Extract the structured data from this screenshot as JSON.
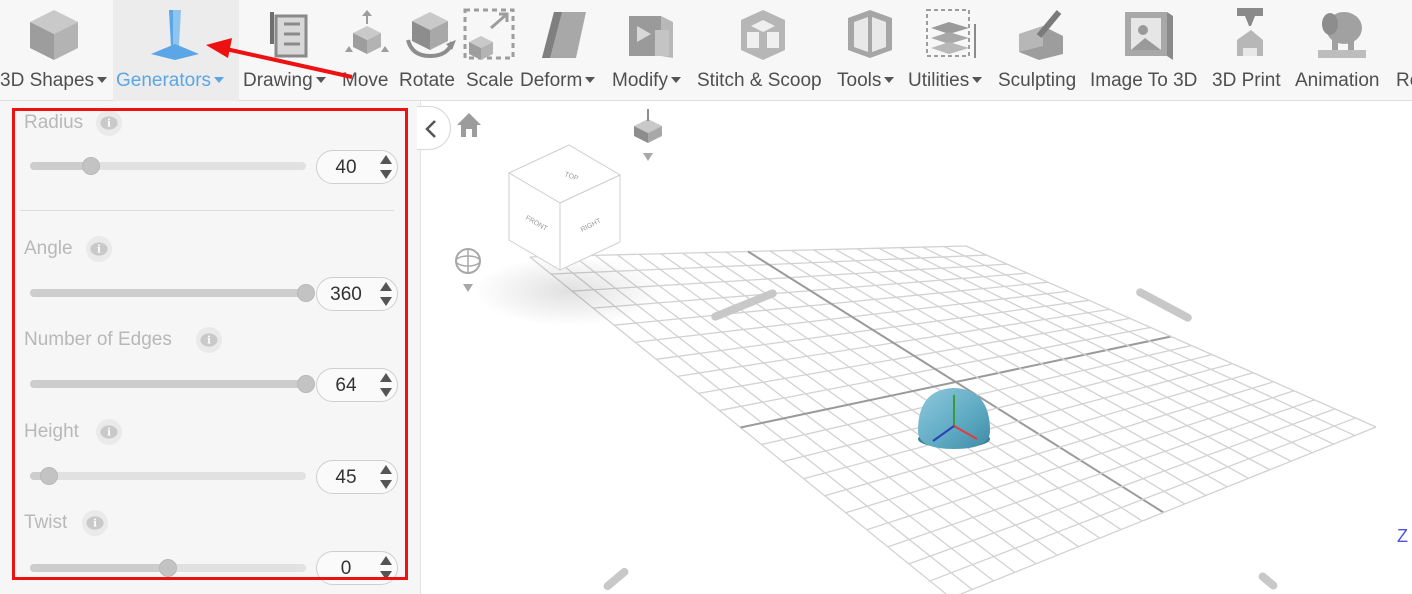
{
  "toolbar": {
    "items": [
      {
        "label": "3D Shapes",
        "has_menu": true,
        "icon": "cube-icon"
      },
      {
        "label": "Generators",
        "has_menu": true,
        "active": true,
        "icon": "generator-icon"
      },
      {
        "label": "Drawing",
        "has_menu": true,
        "icon": "drawing-icon"
      },
      {
        "label": "Move",
        "icon": "move-icon"
      },
      {
        "label": "Rotate",
        "icon": "rotate-icon"
      },
      {
        "label": "Scale",
        "icon": "scale-icon"
      },
      {
        "label": "Deform",
        "has_menu": true,
        "icon": "deform-icon"
      },
      {
        "label": "Modify",
        "has_menu": true,
        "icon": "modify-icon"
      },
      {
        "label": "Stitch & Scoop",
        "icon": "stitch-scoop-icon"
      },
      {
        "label": "Tools",
        "has_menu": true,
        "icon": "tools-icon"
      },
      {
        "label": "Utilities",
        "has_menu": true,
        "icon": "utilities-icon"
      },
      {
        "label": "Sculpting",
        "icon": "sculpting-icon"
      },
      {
        "label": "Image To 3D",
        "icon": "image-to-3d-icon"
      },
      {
        "label": "3D Print",
        "icon": "3d-print-icon"
      },
      {
        "label": "Animation",
        "icon": "animation-icon"
      },
      {
        "label": "Re",
        "icon": "render-icon"
      }
    ],
    "active_color": "#5aa6e6"
  },
  "panel": {
    "params": [
      {
        "label": "Radius",
        "value": "40",
        "fraction": 0.22
      },
      {
        "label": "Angle",
        "value": "360",
        "fraction": 1.0
      },
      {
        "label": "Number of Edges",
        "value": "64",
        "fraction": 1.0
      },
      {
        "label": "Height",
        "value": "45",
        "fraction": 0.07
      },
      {
        "label": "Twist",
        "value": "0",
        "fraction": 0.5
      }
    ]
  },
  "viewcube": {
    "top": "TOP",
    "front": "FRONT",
    "right": "RIGHT"
  },
  "annotation_color": "#ee1111"
}
